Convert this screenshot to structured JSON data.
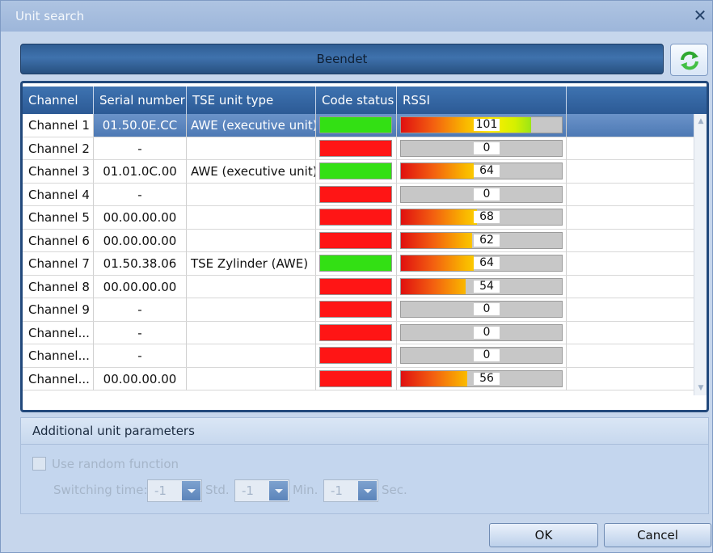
{
  "window": {
    "title": "Unit search"
  },
  "status_text": "Beendet",
  "grid": {
    "columns": [
      "Channel",
      "Serial number",
      "TSE unit type",
      "Code status",
      "RSSI"
    ],
    "rows": [
      {
        "channel": "Channel 1",
        "serial": "01.50.0E.CC",
        "type": "AWE (executive unit)",
        "code": "green",
        "rssi": 101,
        "rssi_fill": 0.81,
        "selected": true
      },
      {
        "channel": "Channel 2",
        "serial": "-",
        "type": "",
        "code": "red",
        "rssi": 0,
        "rssi_fill": 0,
        "selected": false
      },
      {
        "channel": "Channel 3",
        "serial": "01.01.0C.00",
        "type": "AWE (executive unit)",
        "code": "green",
        "rssi": 64,
        "rssi_fill": 0.45,
        "selected": false
      },
      {
        "channel": "Channel 4",
        "serial": "-",
        "type": "",
        "code": "red",
        "rssi": 0,
        "rssi_fill": 0,
        "selected": false
      },
      {
        "channel": "Channel 5",
        "serial": "00.00.00.00",
        "type": "",
        "code": "red",
        "rssi": 68,
        "rssi_fill": 0.47,
        "selected": false
      },
      {
        "channel": "Channel 6",
        "serial": "00.00.00.00",
        "type": "",
        "code": "red",
        "rssi": 62,
        "rssi_fill": 0.44,
        "selected": false
      },
      {
        "channel": "Channel 7",
        "serial": "01.50.38.06",
        "type": "TSE Zylinder (AWE)",
        "code": "green",
        "rssi": 64,
        "rssi_fill": 0.45,
        "selected": false
      },
      {
        "channel": "Channel 8",
        "serial": "00.00.00.00",
        "type": "",
        "code": "red",
        "rssi": 54,
        "rssi_fill": 0.4,
        "selected": false
      },
      {
        "channel": "Channel 9",
        "serial": "-",
        "type": "",
        "code": "red",
        "rssi": 0,
        "rssi_fill": 0,
        "selected": false
      },
      {
        "channel": "Channel...",
        "serial": "-",
        "type": "",
        "code": "red",
        "rssi": 0,
        "rssi_fill": 0,
        "selected": false
      },
      {
        "channel": "Channel...",
        "serial": "-",
        "type": "",
        "code": "red",
        "rssi": 0,
        "rssi_fill": 0,
        "selected": false
      },
      {
        "channel": "Channel...",
        "serial": "00.00.00.00",
        "type": "",
        "code": "red",
        "rssi": 56,
        "rssi_fill": 0.41,
        "selected": false
      }
    ]
  },
  "params": {
    "title": "Additional unit parameters",
    "random_label": "Use random function",
    "random_checked": false,
    "switching_label": "Switching time:",
    "hours_value": "-1",
    "hours_unit": "Std.",
    "minutes_value": "-1",
    "minutes_unit": "Min.",
    "seconds_value": "-1",
    "seconds_unit": "Sec."
  },
  "buttons": {
    "ok": "OK",
    "cancel": "Cancel"
  },
  "colors": {
    "code_green": "#33e014",
    "code_red": "#ff1515",
    "header_blue": "#2c5a95"
  },
  "icons": {
    "refresh": "refresh-icon",
    "close": "close-icon"
  }
}
